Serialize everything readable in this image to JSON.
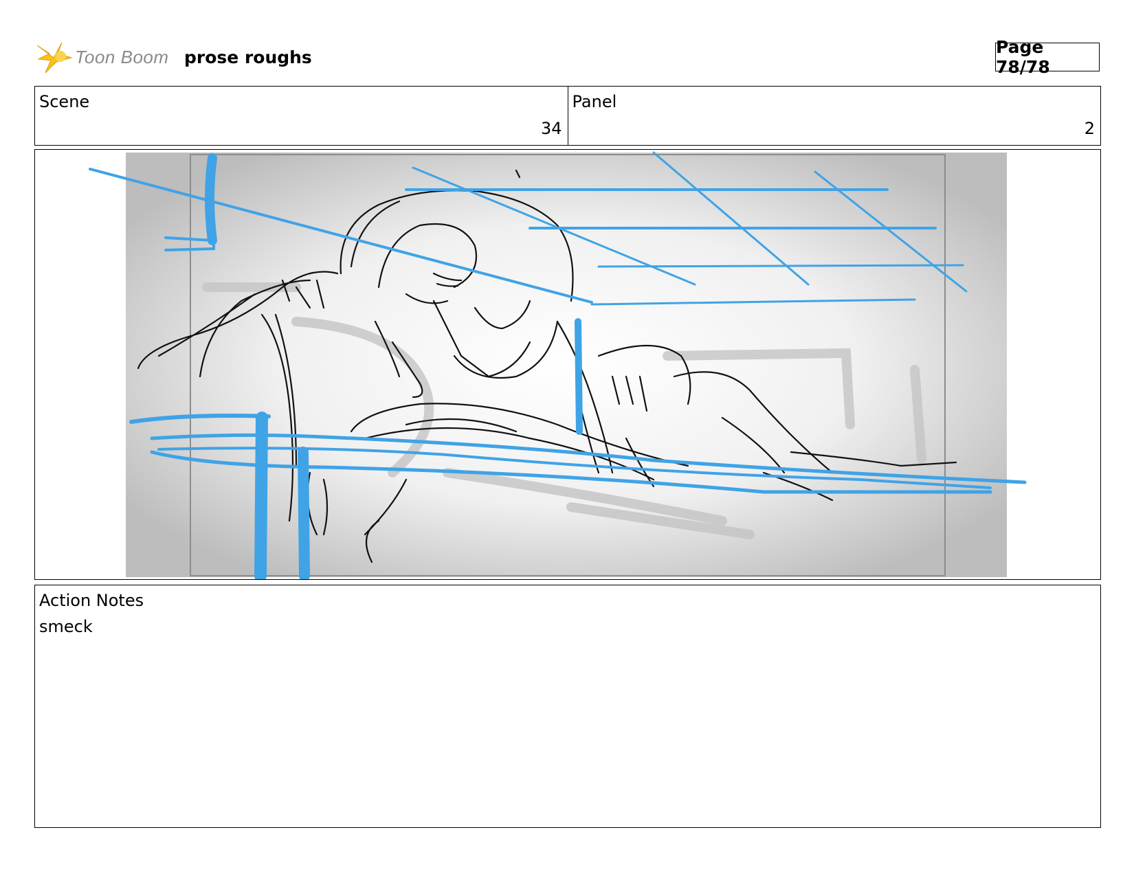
{
  "header": {
    "logo_text": "Toon Boom",
    "project_title": "prose roughs",
    "page_label": "Page 78/78"
  },
  "info": {
    "scene_label": "Scene",
    "scene_value": "34",
    "panel_label": "Panel",
    "panel_value": "2"
  },
  "notes": {
    "label": "Action Notes",
    "text": "smeck"
  },
  "colors": {
    "sketch_blue": "#3fa3e6",
    "sketch_black": "#111111",
    "logo_yellow": "#f7c21b"
  },
  "icons": {
    "logo": "toon-boom-star-icon"
  }
}
